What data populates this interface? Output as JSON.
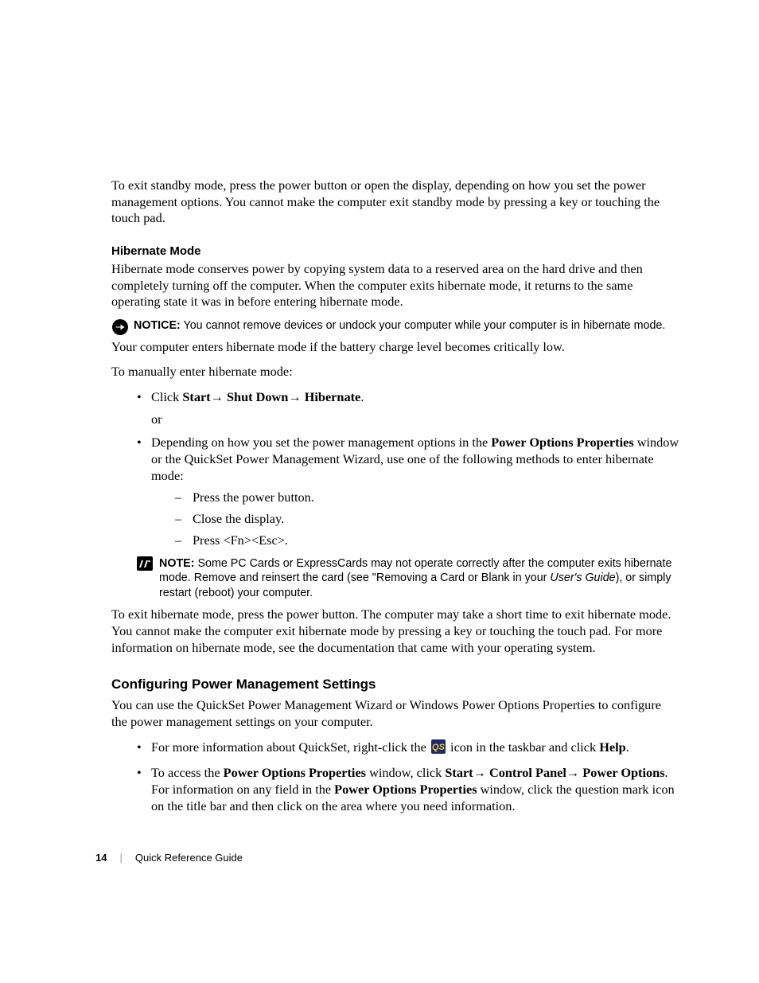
{
  "para_exit_standby": "To exit standby mode, press the power button or open the display, depending on how you set the power management options. You cannot make the computer exit standby mode by pressing a key or touching the touch pad.",
  "subhead_hibernate": "Hibernate Mode",
  "para_hibernate_desc": "Hibernate mode conserves power by copying system data to a reserved area on the hard drive and then completely turning off the computer. When the computer exits hibernate mode, it returns to the same operating state it was in before entering hibernate mode.",
  "notice": {
    "label": "NOTICE:",
    "text": " You cannot remove devices or undock your computer while your computer is in hibernate mode."
  },
  "para_enters_hibernate": "Your computer enters hibernate mode if the battery charge level becomes critically low.",
  "para_manual_enter": "To manually enter hibernate mode:",
  "bullet_click": {
    "prefix": "Click ",
    "b1": "Start",
    "arrow": "→ ",
    "b2": "Shut Down",
    "b3": "Hibernate",
    "suffix": "."
  },
  "or_text": "or",
  "bullet_depending": {
    "prefix": "Depending on how you set the power management options in the ",
    "bold": "Power Options Properties",
    "suffix": " window or the QuickSet Power Management Wizard, use one of the following methods to enter hibernate mode:"
  },
  "dash1": "Press the power button.",
  "dash2": "Close the display.",
  "dash3": "Press <Fn><Esc>.",
  "note": {
    "label": "NOTE:",
    "t1": " Some PC Cards or ExpressCards may not operate correctly after the computer exits hibernate mode. Remove and reinsert the card (see \"Removing a Card or Blank in your ",
    "italic": "User's Guide",
    "t2": "), or simply restart (reboot) your computer."
  },
  "para_exit_hibernate": "To exit hibernate mode, press the power button. The computer may take a short time to exit hibernate mode. You cannot make the computer exit hibernate mode by pressing a key or touching the touch pad. For more information on hibernate mode, see the documentation that came with your operating system.",
  "section_config": "Configuring Power Management Settings",
  "para_config_intro": "You can use the QuickSet Power Management Wizard or Windows Power Options Properties to configure the power management settings on your computer.",
  "bullet_qs": {
    "prefix": "For more information about QuickSet, right-click the ",
    "suffix": " icon in the taskbar and click ",
    "bold": "Help",
    "end": "."
  },
  "bullet_access": {
    "t1": "To access the ",
    "b1": "Power Options Properties",
    "t2": " window, click ",
    "b2": "Start",
    "arrow": "→ ",
    "b3": "Control Panel",
    "b4": "Power Options",
    "t3": ". For information on any field in the ",
    "b5": "Power Options Properties",
    "t4": " window, click the question mark icon on the title bar and then click on the area where you need information."
  },
  "footer": {
    "page": "14",
    "title": "Quick Reference Guide"
  }
}
